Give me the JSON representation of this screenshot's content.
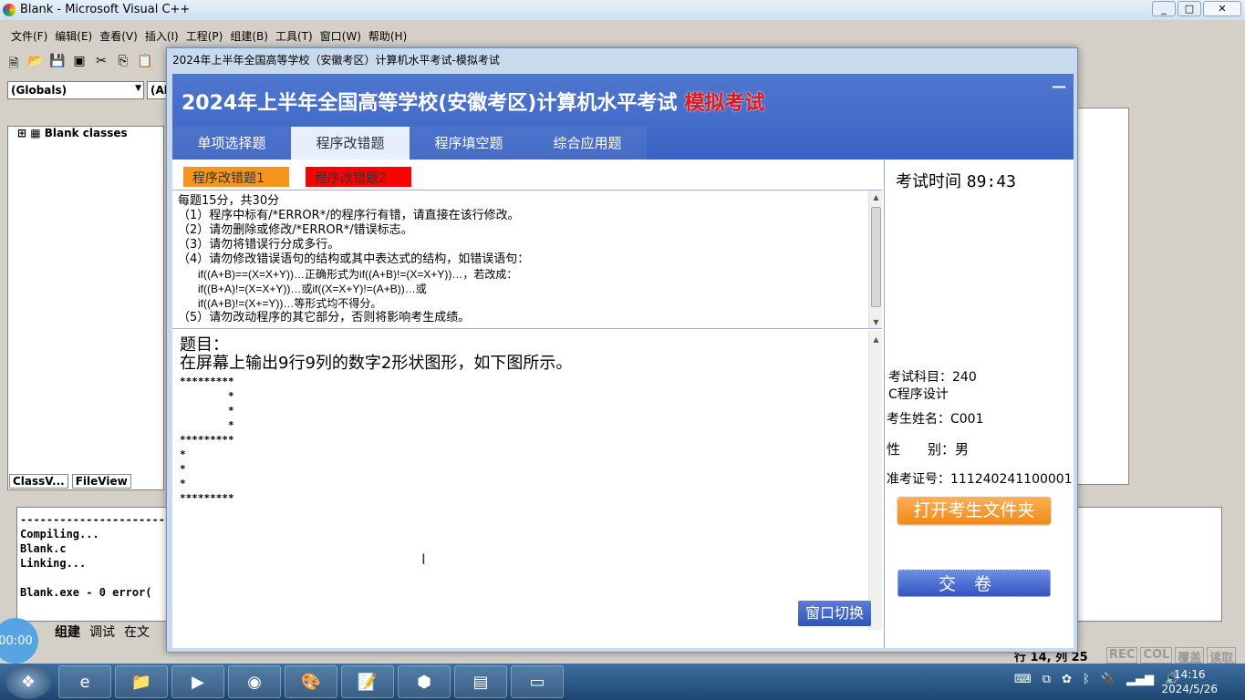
{
  "vc": {
    "title": "Blank - Microsoft Visual C++",
    "menu": [
      "文件(F)",
      "编辑(E)",
      "查看(V)",
      "插入(I)",
      "工程(P)",
      "组建(B)",
      "工具(T)",
      "窗口(W)",
      "帮助(H)"
    ],
    "globals_combo": "(Globals)",
    "members_combo": "(Al",
    "class_tree_root": "Blank classes",
    "pane_tabs": [
      "ClassV...",
      "FileView"
    ],
    "output_lines": [
      "-----------------------",
      "Compiling...",
      "Blank.c",
      "Linking...",
      "",
      "Blank.exe - 0 error("
    ],
    "output_tabs": [
      "组建",
      "调试",
      "在文"
    ],
    "status": {
      "position": "行 14, 列 25",
      "indicators": [
        "REC",
        "COL",
        "覆盖",
        "读取"
      ]
    }
  },
  "exam": {
    "window_title": "2024年上半年全国高等学校（安徽考区）计算机水平考试-模拟考试",
    "header_title": "2024年上半年全国高等学校(安徽考区)计算机水平考试",
    "header_mode": "模拟考试",
    "minimize": "—",
    "tabs": [
      "单项选择题",
      "程序改错题",
      "程序填空题",
      "综合应用题"
    ],
    "active_tab": 1,
    "subtabs": [
      {
        "label": "程序改错题1",
        "color": "#f7941d"
      },
      {
        "label": "程序改错题2",
        "color": "#ff0000"
      }
    ],
    "rules": [
      "每题15分，共30分",
      "（1）程序中标有/*ERROR*/的程序行有错，请直接在该行修改。",
      "（2）请勿删除或修改/*ERROR*/错误标志。",
      "（3）请勿将错误行分成多行。",
      "（4）请勿修改错误语句的结构或其中表达式的结构，如错误语句："
    ],
    "rules_code": [
      "if((A+B)==(X=X+Y))…正确形式为if((A+B)!=(X=X+Y))…，若改成：",
      "if((B+A)!=(X=X+Y))…或if((X=X+Y)!=(A+B))…或",
      "if((A+B)!=(X+=Y))…等形式均不得分。"
    ],
    "rules_last": "（5）请勿改动程序的其它部分，否则将影响考生成绩。",
    "question_label": "题目：",
    "question_text": "在屏幕上输出9行9列的数字2形状图形，如下图所示。",
    "pattern": "*********\n        *\n        *\n        *\n*********\n*\n*\n*\n*********",
    "switch_button": "窗口切换",
    "exam_time_label": "考试时间",
    "exam_time": "89:43",
    "subject_label": "考试科目：",
    "subject_code": "240",
    "subject_name": "C程序设计",
    "name_label": "考生姓名：",
    "name": "C001",
    "gender_label": "性　　别：",
    "gender": "男",
    "id_label": "准考证号：",
    "id": "111240241100001",
    "open_folder_button": "打开考生文件夹",
    "submit_button": "交卷"
  },
  "taskbar": {
    "time": "14:16",
    "date": "2024/5/26",
    "timer": "00:00"
  },
  "colors": {
    "header_blue": "#3b63c4",
    "accent_red": "#e5161a",
    "orange_button": "#f7941d"
  }
}
